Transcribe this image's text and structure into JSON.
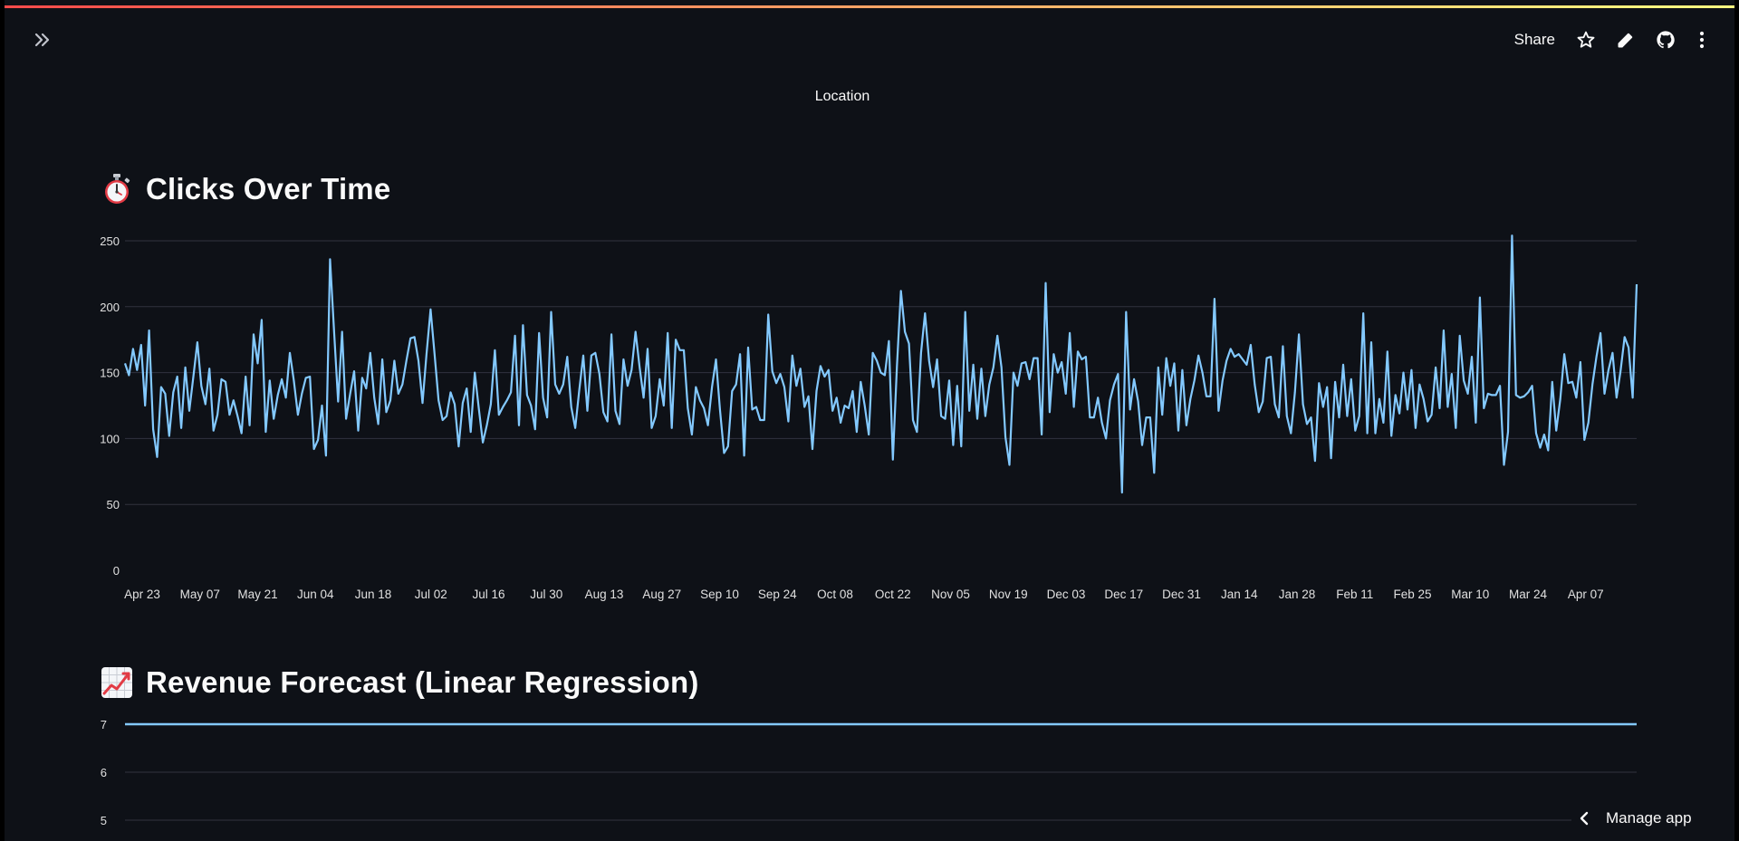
{
  "app": {
    "share_label": "Share",
    "manage_label": "Manage app",
    "location_label": "Location"
  },
  "icons": {
    "sidebar": "double-chevron-right-icon",
    "star": "star-icon",
    "edit": "pencil-icon",
    "github": "github-icon",
    "more": "vertical-dots-icon",
    "back": "chevron-left-icon"
  },
  "colors": {
    "background": "#0e1117",
    "line": "#83c9ff",
    "grid": "#31333f",
    "text": "#fafafa",
    "axis_text": "#e0e0e0"
  },
  "sections": {
    "clicks_title": "Clicks Over Time",
    "revenue_title": "Revenue Forecast (Linear Regression)"
  },
  "chart_data": [
    {
      "type": "line",
      "title": "Clicks Over Time",
      "xlabel": "",
      "ylabel": "",
      "x_tick_labels": [
        "Apr 23",
        "May 07",
        "May 21",
        "Jun 04",
        "Jun 18",
        "Jul 02",
        "Jul 16",
        "Jul 30",
        "Aug 13",
        "Aug 27",
        "Sep 10",
        "Sep 24",
        "Oct 08",
        "Oct 22",
        "Nov 05",
        "Nov 19",
        "Dec 03",
        "Dec 17",
        "Dec 31",
        "Jan 14",
        "Jan 28",
        "Feb 11",
        "Feb 25",
        "Mar 10",
        "Mar 24",
        "Apr 07"
      ],
      "y_ticks": [
        0,
        50,
        100,
        150,
        200,
        250
      ],
      "ylim": [
        0,
        250
      ],
      "grid": true,
      "values": [
        157,
        148,
        168,
        152,
        171,
        125,
        182,
        107,
        86,
        139,
        134,
        102,
        135,
        147,
        108,
        154,
        121,
        147,
        173,
        140,
        126,
        153,
        106,
        118,
        145,
        143,
        118,
        129,
        117,
        104,
        147,
        110,
        179,
        157,
        190,
        105,
        144,
        115,
        133,
        145,
        131,
        165,
        144,
        118,
        134,
        146,
        147,
        92,
        99,
        125,
        87,
        236,
        182,
        128,
        181,
        115,
        134,
        151,
        106,
        146,
        138,
        165,
        131,
        111,
        160,
        120,
        129,
        159,
        134,
        141,
        159,
        176,
        177,
        159,
        127,
        164,
        198,
        164,
        129,
        114,
        117,
        135,
        126,
        94,
        127,
        138,
        105,
        150,
        123,
        97,
        110,
        126,
        167,
        118,
        124,
        129,
        135,
        178,
        110,
        186,
        133,
        125,
        107,
        180,
        131,
        116,
        196,
        141,
        134,
        141,
        162,
        124,
        108,
        137,
        163,
        121,
        163,
        165,
        149,
        120,
        113,
        179,
        121,
        111,
        160,
        140,
        152,
        181,
        154,
        131,
        168,
        108,
        117,
        145,
        125,
        180,
        108,
        175,
        167,
        167,
        123,
        103,
        139,
        129,
        123,
        110,
        139,
        160,
        122,
        89,
        94,
        136,
        141,
        164,
        87,
        169,
        122,
        124,
        114,
        114,
        194,
        151,
        142,
        149,
        139,
        113,
        163,
        140,
        153,
        124,
        132,
        92,
        136,
        155,
        147,
        152,
        121,
        131,
        112,
        125,
        123,
        136,
        105,
        143,
        125,
        103,
        165,
        159,
        150,
        148,
        174,
        84,
        155,
        212,
        181,
        172,
        114,
        105,
        165,
        195,
        159,
        139,
        160,
        117,
        115,
        144,
        95,
        140,
        94,
        196,
        121,
        156,
        115,
        153,
        117,
        141,
        154,
        178,
        154,
        101,
        80,
        150,
        140,
        157,
        158,
        145,
        161,
        161,
        103,
        218,
        120,
        164,
        150,
        158,
        134,
        180,
        124,
        166,
        160,
        162,
        116,
        116,
        131,
        112,
        100,
        129,
        141,
        149,
        59,
        196,
        122,
        145,
        128,
        95,
        116,
        116,
        74,
        154,
        118,
        161,
        140,
        157,
        106,
        152,
        110,
        130,
        144,
        163,
        150,
        132,
        132,
        206,
        121,
        144,
        159,
        168,
        162,
        164,
        160,
        156,
        171,
        141,
        120,
        128,
        161,
        162,
        126,
        116,
        170,
        117,
        104,
        135,
        179,
        126,
        111,
        116,
        83,
        142,
        124,
        139,
        85,
        143,
        116,
        156,
        117,
        145,
        106,
        117,
        195,
        104,
        173,
        104,
        130,
        112,
        166,
        102,
        133,
        119,
        150,
        122,
        152,
        108,
        141,
        130,
        113,
        118,
        154,
        123,
        182,
        124,
        149,
        108,
        178,
        144,
        134,
        162,
        112,
        207,
        123,
        134,
        133,
        133,
        140,
        80,
        105,
        254,
        133,
        131,
        132,
        135,
        140,
        104,
        93,
        103,
        91,
        143,
        106,
        130,
        164,
        142,
        143,
        131,
        158,
        99,
        112,
        141,
        162,
        180,
        134,
        152,
        165,
        131,
        151,
        177,
        169,
        131,
        217
      ]
    },
    {
      "type": "line",
      "title": "Revenue Forecast (Linear Regression)",
      "xlabel": "",
      "ylabel": "",
      "y_ticks": [
        5,
        6,
        7
      ],
      "ylim": [
        5,
        7
      ],
      "grid": true,
      "values": [
        7,
        7
      ]
    }
  ]
}
